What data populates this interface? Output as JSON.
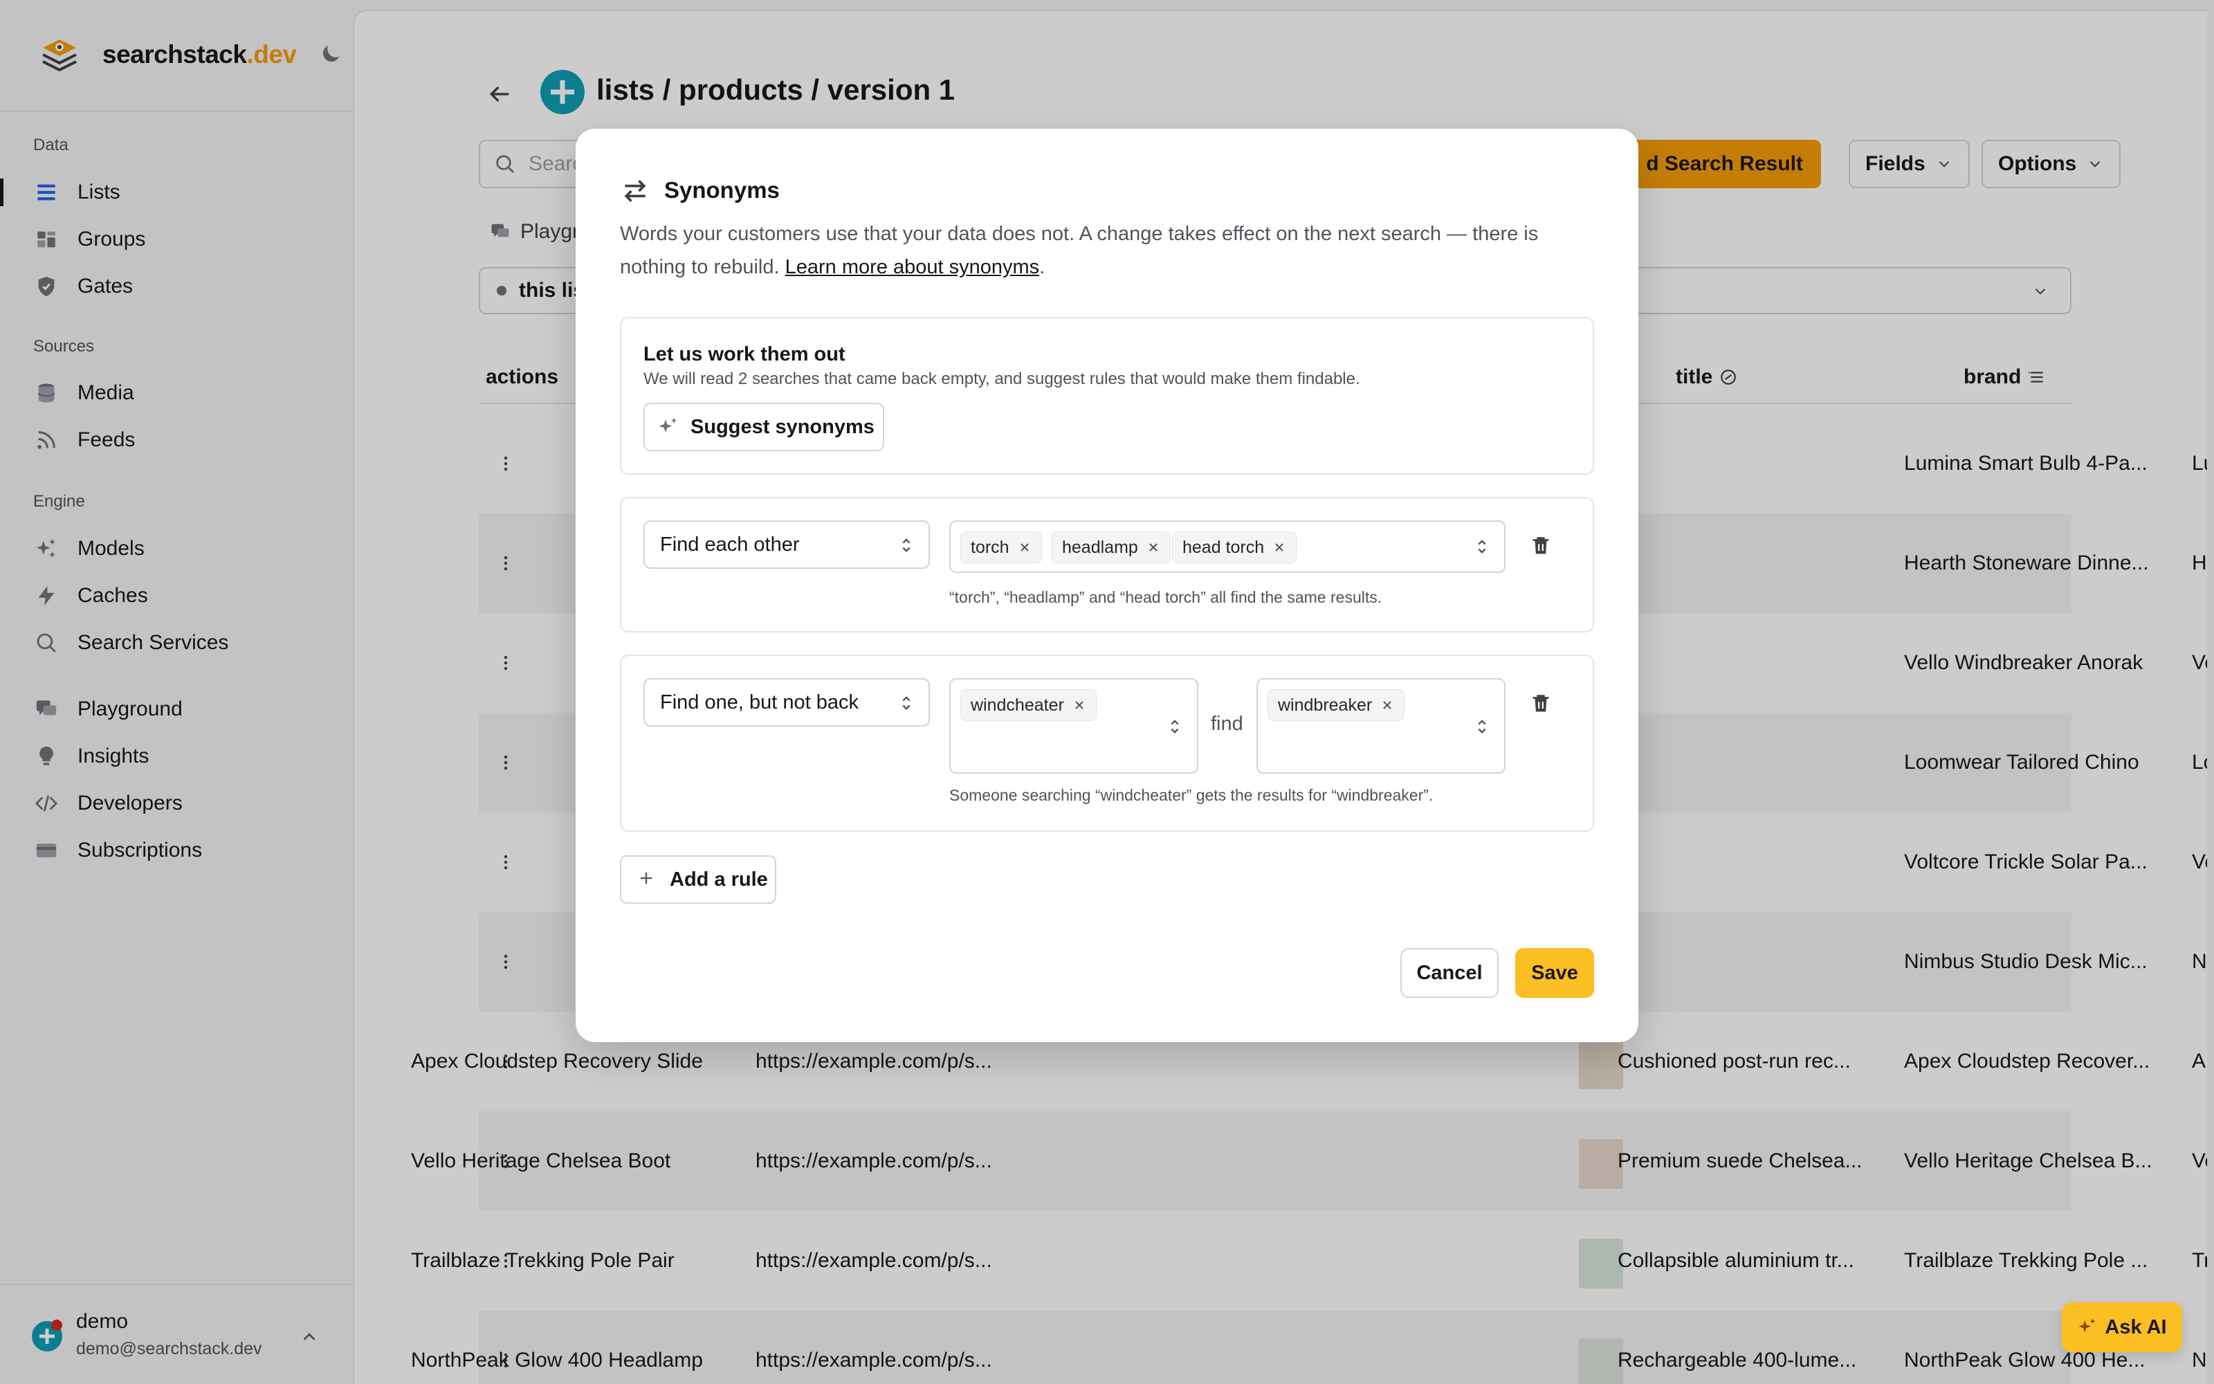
{
  "brand": {
    "name": "searchstack",
    "tld": ".dev"
  },
  "sidebar": {
    "sections": [
      {
        "label": "Data"
      },
      {
        "label": "Sources"
      },
      {
        "label": "Engine"
      }
    ],
    "items": [
      {
        "label": "Lists",
        "icon": "list-icon",
        "active": true
      },
      {
        "label": "Groups",
        "icon": "groups-icon"
      },
      {
        "label": "Gates",
        "icon": "shield-icon"
      },
      {
        "label": "Media",
        "icon": "database-icon"
      },
      {
        "label": "Feeds",
        "icon": "rss-icon"
      },
      {
        "label": "Models",
        "icon": "sparkles-icon"
      },
      {
        "label": "Caches",
        "icon": "bolt-icon"
      },
      {
        "label": "Search Services",
        "icon": "search-icon"
      },
      {
        "label": "Playground",
        "icon": "chat-icon"
      },
      {
        "label": "Insights",
        "icon": "bulb-icon"
      },
      {
        "label": "Developers",
        "icon": "code-icon"
      },
      {
        "label": "Subscriptions",
        "icon": "card-icon"
      }
    ],
    "user": {
      "name": "demo",
      "email": "demo@searchstack.dev"
    }
  },
  "header": {
    "title": "lists / products / version 1",
    "search_placeholder": "Search",
    "add_result_label": "d Search Result",
    "fields_label": "Fields",
    "options_label": "Options",
    "tab_label": "Playgr",
    "filter_label": "this lis"
  },
  "table": {
    "columns": {
      "actions": "actions",
      "title": "title",
      "brand": "brand"
    },
    "rows": [
      {
        "name": "",
        "url": "",
        "desc": "",
        "title": "Lumina Smart Bulb 4-Pa...",
        "brand": "Lumina"
      },
      {
        "name": "",
        "url": "",
        "desc": "",
        "title": "Hearth Stoneware Dinne...",
        "brand": "Hearth"
      },
      {
        "name": "",
        "url": "",
        "desc": "",
        "title": "Vello Windbreaker Anorak",
        "brand": "Vello"
      },
      {
        "name": "",
        "url": "",
        "desc": "",
        "title": "Loomwear Tailored Chino",
        "brand": "Loomwear"
      },
      {
        "name": "",
        "url": "",
        "desc": "",
        "title": "Voltcore Trickle Solar Pa...",
        "brand": "Voltcore"
      },
      {
        "name": "",
        "url": "",
        "desc": "",
        "title": "Nimbus Studio Desk Mic...",
        "brand": "Nimbus"
      },
      {
        "name": "Apex Cloudstep Recovery Slide",
        "url": "https://example.com/p/s...",
        "desc": "Cushioned post-run rec...",
        "title": "Apex Cloudstep Recover...",
        "brand": "Apex"
      },
      {
        "name": "Vello Heritage Chelsea Boot",
        "url": "https://example.com/p/s...",
        "desc": "Premium suede Chelsea...",
        "title": "Vello Heritage Chelsea B...",
        "brand": "Vello"
      },
      {
        "name": "Trailblaze Trekking Pole Pair",
        "url": "https://example.com/p/s...",
        "desc": "Collapsible aluminium tr...",
        "title": "Trailblaze Trekking Pole ...",
        "brand": "Trailblaze"
      },
      {
        "name": "NorthPeak Glow 400 Headlamp",
        "url": "https://example.com/p/s...",
        "desc": "Rechargeable 400-lume...",
        "title": "NorthPeak Glow 400 He...",
        "brand": "NorthPeak"
      }
    ]
  },
  "modal": {
    "title": "Synonyms",
    "desc_text": "Words your customers use that your data does not. A change takes effect on the next search — there is nothing to rebuild. ",
    "learn_more": "Learn more about synonyms",
    "desc_end": ".",
    "suggest": {
      "title": "Let us work them out",
      "subtitle": "We will read 2 searches that came back empty, and suggest rules that would make them findable.",
      "button": "Suggest synonyms"
    },
    "rule1": {
      "mode": "Find each other",
      "terms": [
        "torch",
        "headlamp",
        "head torch"
      ],
      "hint": "“torch”, “headlamp” and “head torch” all find the same results."
    },
    "rule2": {
      "mode": "Find one, but not back",
      "from_terms": [
        "windcheater"
      ],
      "find_word": "find",
      "to_terms": [
        "windbreaker"
      ],
      "hint": "Someone searching “windcheater” gets the results for “windbreaker”."
    },
    "add_rule": "Add a rule",
    "cancel": "Cancel",
    "save": "Save"
  },
  "ask_ai": "Ask AI",
  "colors": {
    "accent": "#f59e0b",
    "save": "#fbbf24",
    "badge": "#0e9fb5"
  }
}
